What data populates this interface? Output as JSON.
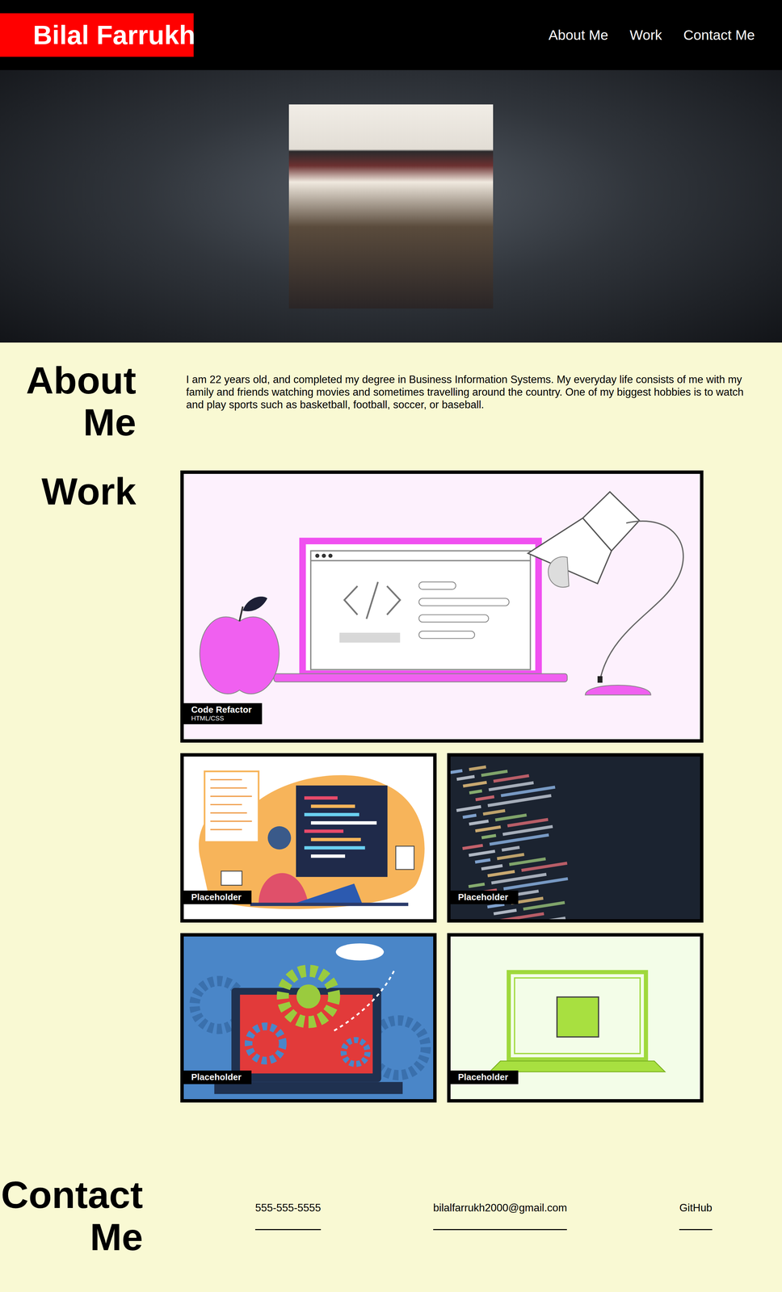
{
  "header": {
    "logo": "Bilal Farrukh",
    "nav": [
      {
        "label": "About Me"
      },
      {
        "label": "Work"
      },
      {
        "label": "Contact Me"
      }
    ]
  },
  "about": {
    "heading": "About Me",
    "text": "I am 22 years old, and completed my degree in Business Information Systems. My everyday life consists of me with my family and friends watching movies and sometimes travelling around the country. One of my biggest hobbies is to watch and play sports such as basketball, football, soccer, or baseball."
  },
  "work": {
    "heading": "Work",
    "projects": [
      {
        "title": "Code Refactor",
        "subtitle": "HTML/CSS",
        "kind": "laptop-desk"
      },
      {
        "title": "Placeholder",
        "kind": "python-dev"
      },
      {
        "title": "Placeholder",
        "kind": "code-screen"
      },
      {
        "title": "Placeholder",
        "kind": "gears"
      },
      {
        "title": "Placeholder",
        "kind": "js-laptop"
      }
    ]
  },
  "contact": {
    "heading": "Contact Me",
    "links": [
      {
        "label": "555-555-5555"
      },
      {
        "label": "bilalfarrukh2000@gmail.com"
      },
      {
        "label": "GitHub"
      }
    ]
  }
}
